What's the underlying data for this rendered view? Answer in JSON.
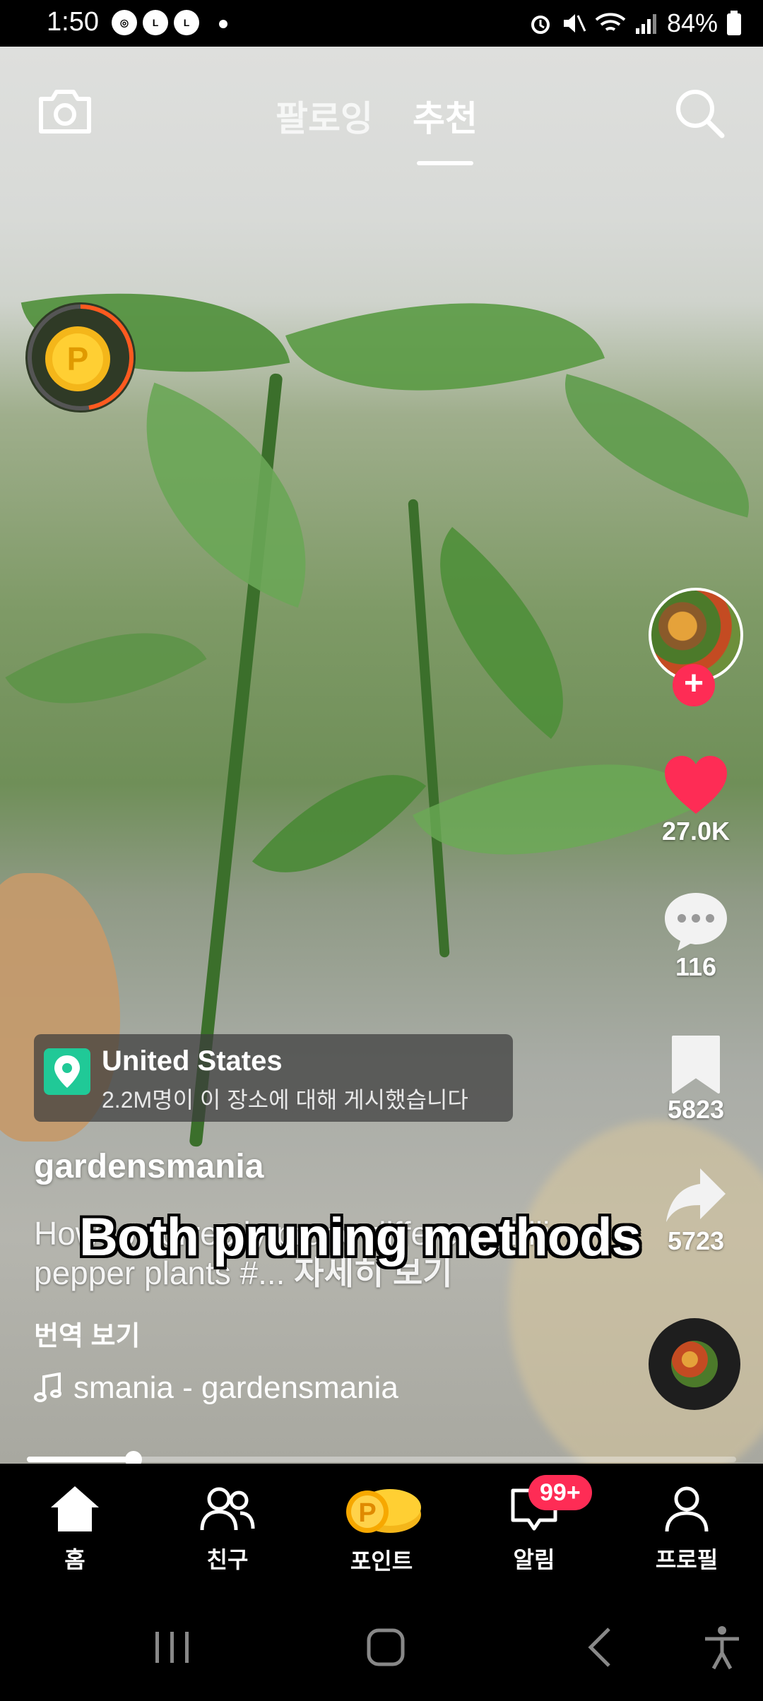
{
  "status_bar": {
    "time": "1:50",
    "notif_icons": [
      "chrome-icon",
      "lock-icon",
      "lock-icon"
    ],
    "battery": "84%"
  },
  "top_nav": {
    "tabs": [
      {
        "label": "팔로잉",
        "active": false
      },
      {
        "label": "추천",
        "active": true
      }
    ]
  },
  "location": {
    "title": "United States",
    "subtitle": "2.2M명이 이 장소에 대해 게시했습니다"
  },
  "post": {
    "username": "gardensmania",
    "caption": "How to correctly prune different chili pepper plants #...",
    "more": "자세히 보기",
    "overlay_text": "Both pruning methods",
    "translate": "번역 보기",
    "music": "smania - gardensmania"
  },
  "actions": {
    "likes": "27.0K",
    "comments": "116",
    "saves": "5823",
    "shares": "5723"
  },
  "progress": 0.15,
  "bottom_nav": {
    "items": [
      {
        "label": "홈",
        "icon": "home-icon",
        "active": true
      },
      {
        "label": "친구",
        "icon": "friends-icon"
      },
      {
        "label": "포인트",
        "icon": "points-coin-icon"
      },
      {
        "label": "알림",
        "icon": "inbox-icon"
      },
      {
        "label": "프로필",
        "icon": "profile-icon"
      }
    ],
    "inbox_badge": "99+"
  },
  "colors": {
    "accent": "#fe2c55",
    "location_pin": "#20c997"
  }
}
